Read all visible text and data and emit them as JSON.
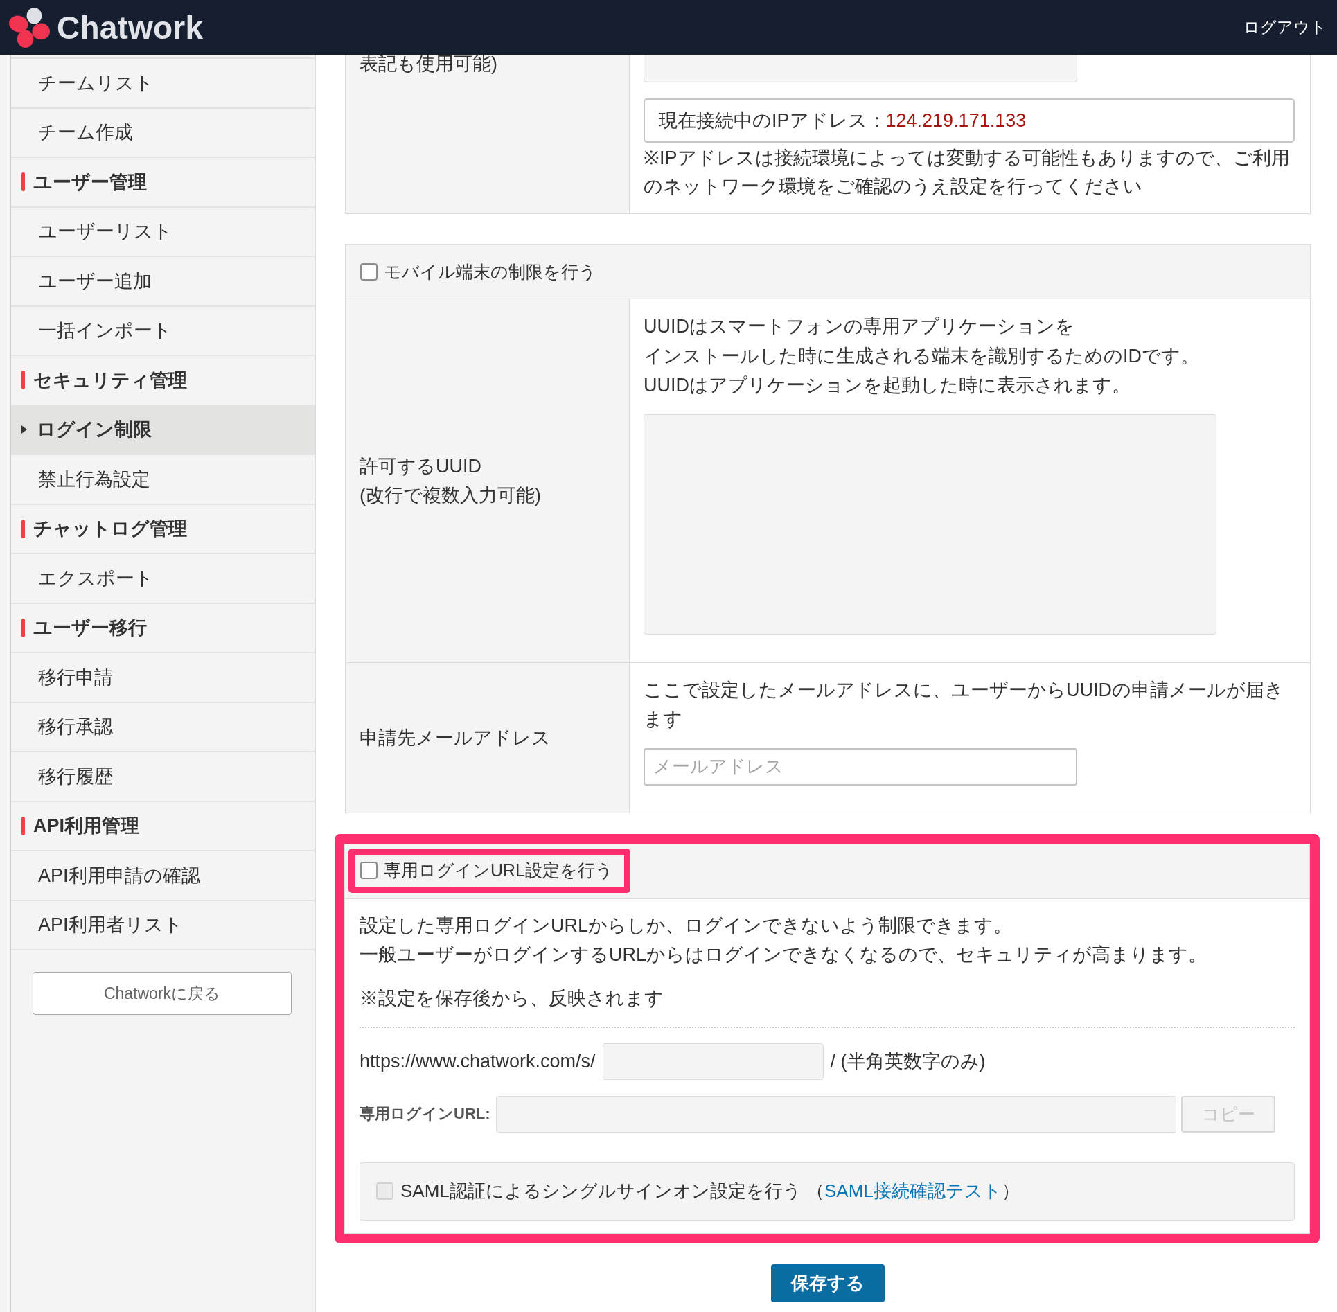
{
  "header": {
    "brand": "Chatwork",
    "logout": "ログアウト"
  },
  "sidebar": {
    "groups": [
      {
        "items": [
          {
            "label": "チームリスト",
            "selected": false
          },
          {
            "label": "チーム作成",
            "selected": false
          }
        ]
      },
      {
        "heading": "ユーザー管理",
        "items": [
          {
            "label": "ユーザーリスト",
            "selected": false
          },
          {
            "label": "ユーザー追加",
            "selected": false
          },
          {
            "label": "一括インポート",
            "selected": false
          }
        ]
      },
      {
        "heading": "セキュリティ管理",
        "items": [
          {
            "label": "ログイン制限",
            "selected": true
          },
          {
            "label": "禁止行為設定",
            "selected": false
          }
        ]
      },
      {
        "heading": "チャットログ管理",
        "items": [
          {
            "label": "エクスポート",
            "selected": false
          }
        ]
      },
      {
        "heading": "ユーザー移行",
        "items": [
          {
            "label": "移行申請",
            "selected": false
          },
          {
            "label": "移行承認",
            "selected": false
          },
          {
            "label": "移行履歴",
            "selected": false
          }
        ]
      },
      {
        "heading": "API利用管理",
        "items": [
          {
            "label": "API利用申請の確認",
            "selected": false
          },
          {
            "label": "API利用者リスト",
            "selected": false
          }
        ]
      }
    ],
    "back_button": "Chatworkに戻る"
  },
  "ip_section": {
    "label": "表記も使用可能)",
    "ip_list_field": {
      "disabled": true
    },
    "current_ip_label": "現在接続中のIPアドレス：",
    "current_ip": "124.219.171.133",
    "note": "※IPアドレスは接続環境によっては変動する可能性もありますので、ご利用のネットワーク環境をご確認のうえ設定を行ってください"
  },
  "mobile_section": {
    "checkbox": {
      "label": "モバイル端末の制限を行う",
      "checked": false
    },
    "rows": [
      {
        "kind": "textarea",
        "label": "許可するUUID\n(改行で複数入力可能)",
        "description_lines": [
          "UUIDはスマートフォンの専用アプリケーションを",
          "インストールした時に生成される端末を識別するためのIDです。",
          "UUIDはアプリケーションを起動した時に表示されます。"
        ],
        "field": {
          "disabled": true
        }
      },
      {
        "kind": "input",
        "label": "申請先メールアドレス",
        "description_lines": [
          "ここで設定したメールアドレスに、ユーザーからUUIDの申請メールが届きます"
        ],
        "field": {
          "placeholder": "メールアドレス",
          "disabled": false
        }
      }
    ]
  },
  "login_url_section": {
    "highlighted": true,
    "checkbox": {
      "label": "専用ログインURL設定を行う",
      "checked": false,
      "highlighted": true
    },
    "description_lines": [
      "設定した専用ログインURLからしか、ログインできないよう制限できます。",
      "一般ユーザーがログインするURLからはログインできなくなるので、セキュリティが高まります。"
    ],
    "note": "※設定を保存後から、反映されます",
    "url_prefix": "https://www.chatwork.com/s/",
    "slug_field": {
      "disabled": true
    },
    "url_suffix": "/ (半角英数字のみ)",
    "login_url_label": "専用ログインURL:",
    "login_url_field": {
      "disabled": true
    },
    "copy_button": {
      "label": "コピー",
      "disabled": true
    },
    "saml": {
      "checkbox": {
        "label": "SAML認証によるシングルサインオン設定を行う",
        "checked": false,
        "disabled": true
      },
      "paren_open": "（",
      "link": "SAML接続確認テスト",
      "paren_close": "）"
    }
  },
  "save_button": "保存する"
}
